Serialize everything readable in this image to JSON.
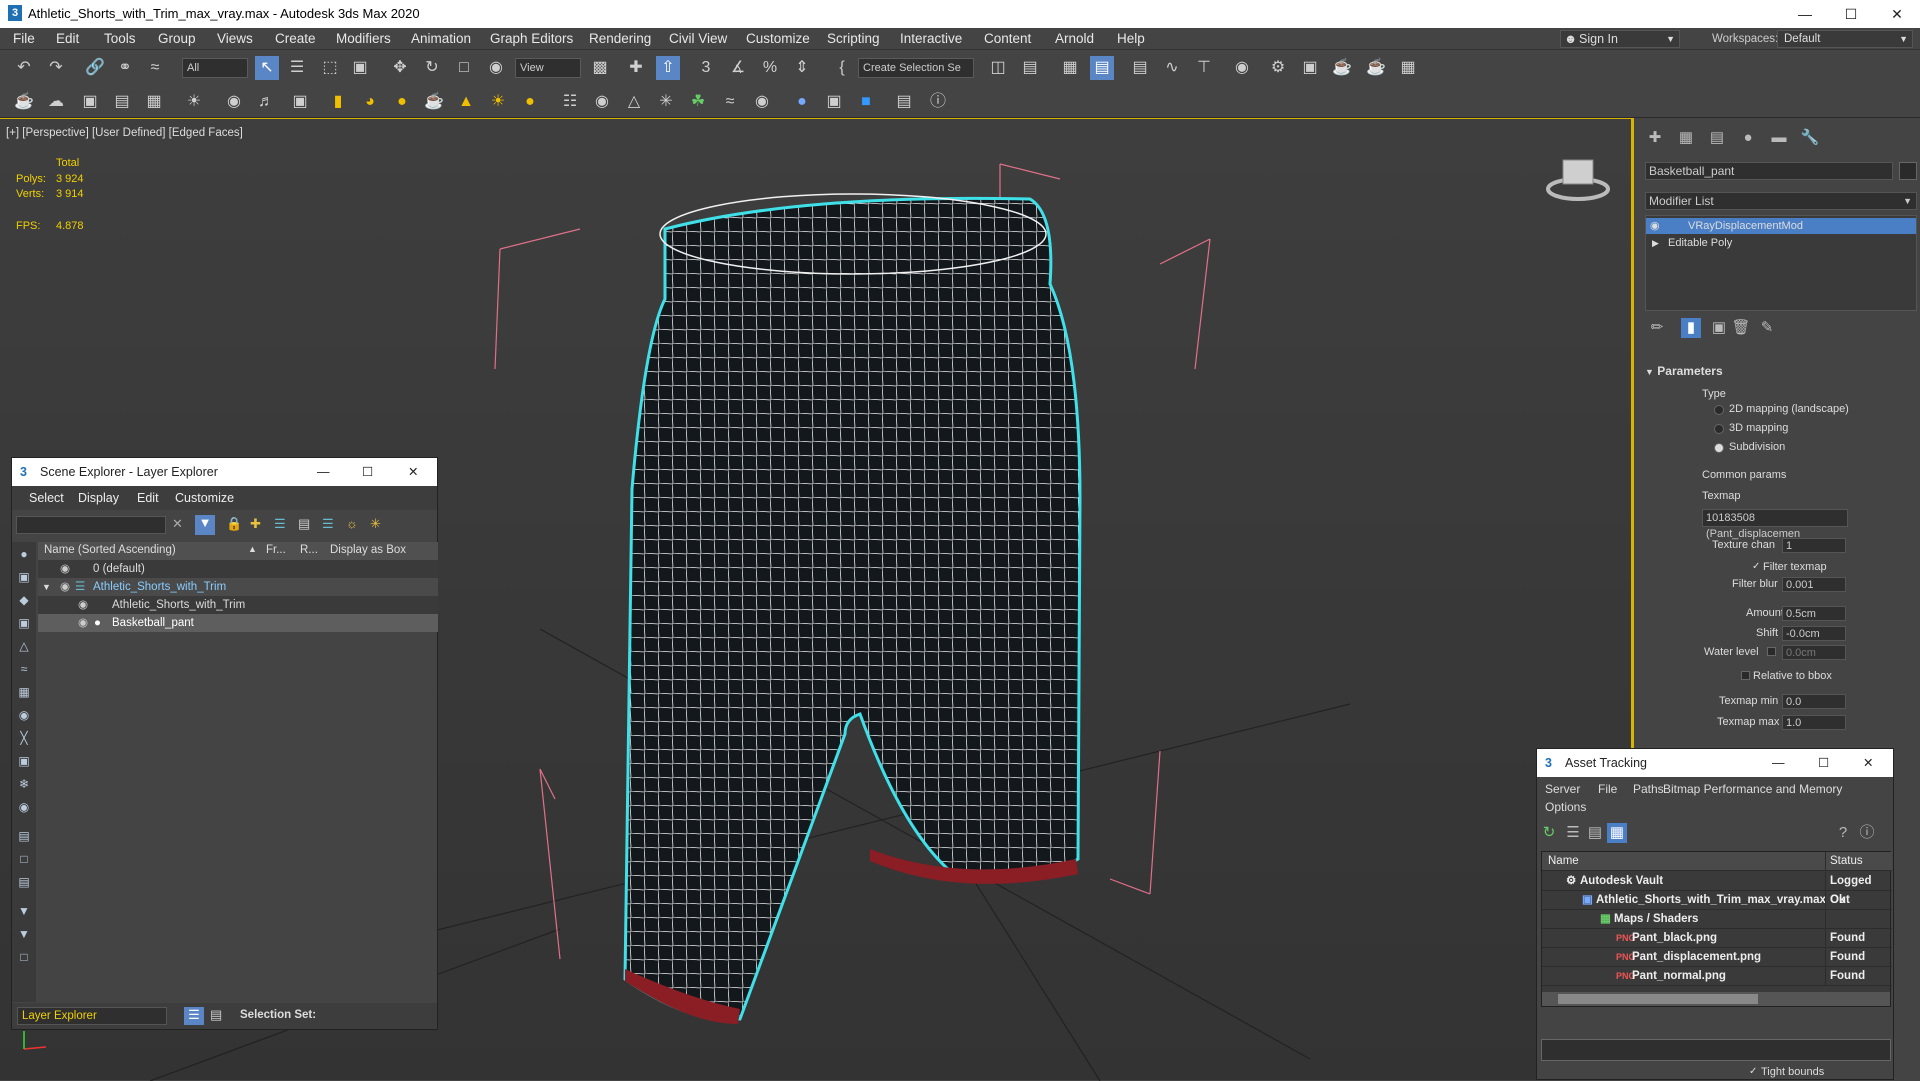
{
  "window": {
    "title": "Athletic_Shorts_with_Trim_max_vray.max - Autodesk 3ds Max 2020",
    "app_icon": "3"
  },
  "menu": [
    "File",
    "Edit",
    "Tools",
    "Group",
    "Views",
    "Create",
    "Modifiers",
    "Animation",
    "Graph Editors",
    "Rendering",
    "Civil View",
    "Customize",
    "Scripting",
    "Interactive",
    "Content",
    "Arnold",
    "Help"
  ],
  "signin": "Sign In",
  "workspaces": {
    "label": "Workspaces:",
    "value": "Default"
  },
  "toolbar": {
    "filter": "All",
    "refcoord": "View",
    "selection_set": "Create Selection Se"
  },
  "viewport": {
    "label": "[+] [Perspective] [User Defined] [Edged Faces]",
    "stats": {
      "total_label": "Total",
      "polys_label": "Polys:",
      "polys": "3 924",
      "verts_label": "Verts:",
      "verts": "3 914",
      "fps_label": "FPS:",
      "fps": "4.878"
    }
  },
  "scene_explorer": {
    "title": "Scene Explorer - Layer Explorer",
    "menu": [
      "Select",
      "Display",
      "Edit",
      "Customize"
    ],
    "columns": {
      "name": "Name (Sorted Ascending)",
      "frozen": "Fr...",
      "render": "R...",
      "display_box": "Display as Box"
    },
    "rows": [
      "0 (default)",
      "Athletic_Shorts_with_Trim",
      "Athletic_Shorts_with_Trim",
      "Basketball_pant"
    ],
    "footer_layer": "Layer Explorer",
    "footer_selset": "Selection Set:"
  },
  "command_panel": {
    "object_name": "Basketball_pant",
    "modifier_list": "Modifier List",
    "stack": [
      "VRayDisplacementMod",
      "Editable Poly"
    ],
    "rollout": "Parameters",
    "type_label": "Type",
    "types": [
      "2D mapping (landscape)",
      "3D mapping",
      "Subdivision"
    ],
    "common_params": "Common params",
    "texmap_label": "Texmap",
    "texmap": "10183508 (Pant_displacemen",
    "texture_chan_label": "Texture chan",
    "texture_chan": "1",
    "filter_texmap": "Filter texmap",
    "filter_blur_label": "Filter blur",
    "filter_blur": "0.001",
    "amount_label": "Amount",
    "amount": "0.5cm",
    "shift_label": "Shift",
    "shift": "-0.0cm",
    "water_label": "Water level",
    "water": "0.0cm",
    "relative_bbox": "Relative to bbox",
    "texmap_min_label": "Texmap min",
    "texmap_min": "0.0",
    "texmap_max_label": "Texmap max",
    "texmap_max": "1.0"
  },
  "asset_tracking": {
    "title": "Asset Tracking",
    "menu": [
      "Server",
      "File",
      "Paths",
      "Bitmap Performance and Memory",
      "Options"
    ],
    "col_name": "Name",
    "col_status": "Status",
    "rows": [
      {
        "name": "Autodesk Vault",
        "status": "Logged Out"
      },
      {
        "name": "Athletic_Shorts_with_Trim_max_vray.max",
        "status": "Ok"
      },
      {
        "name": "Maps / Shaders",
        "status": ""
      },
      {
        "name": "Pant_black.png",
        "status": "Found"
      },
      {
        "name": "Pant_displacement.png",
        "status": "Found"
      },
      {
        "name": "Pant_normal.png",
        "status": "Found"
      }
    ],
    "tight_bounds": "Tight bounds"
  },
  "colors": {
    "accent": "#d8b400",
    "selection": "#4a7fc6",
    "wire": "#ffffff",
    "highlight": "#3fe0e8"
  }
}
